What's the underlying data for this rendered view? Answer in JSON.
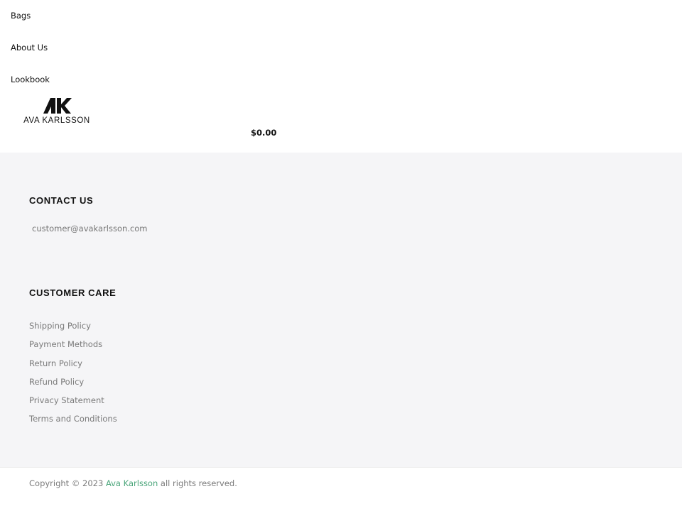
{
  "nav": {
    "items": [
      {
        "label": "Bags"
      },
      {
        "label": "About Us"
      },
      {
        "label": "Lookbook"
      }
    ]
  },
  "logo": {
    "monogram": "AK",
    "text": "AVA KARLSSON"
  },
  "cart": {
    "total": "$0.00"
  },
  "contact": {
    "title": "CONTACT US",
    "email": "customer@avakarlsson.com"
  },
  "customer_care": {
    "title": "CUSTOMER CARE",
    "links": [
      {
        "label": "Shipping Policy"
      },
      {
        "label": "Payment Methods"
      },
      {
        "label": "Return Policy"
      },
      {
        "label": "Refund Policy"
      },
      {
        "label": "Privacy Statement"
      },
      {
        "label": "Terms and Conditions"
      }
    ]
  },
  "copyright": {
    "prefix": "Copyright © 2023",
    "brand": "Ava Karlsson",
    "suffix": "all rights reserved."
  },
  "colors": {
    "footer_bg": "#f5f5f7",
    "link_muted": "#7a7a7a",
    "brand_accent": "#4aa57a"
  }
}
